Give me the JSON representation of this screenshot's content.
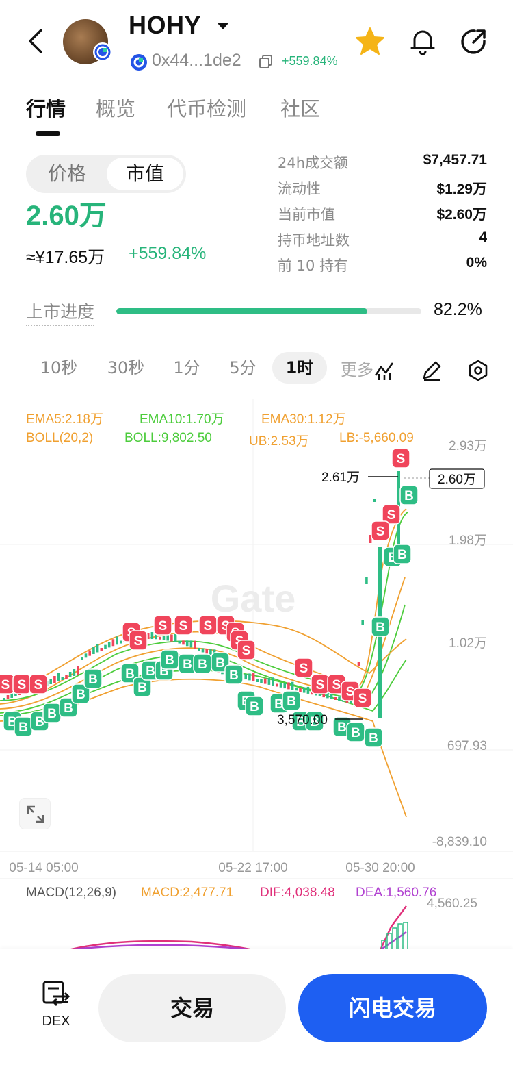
{
  "header": {
    "token_name": "HOHY",
    "address": "0x44...1de2",
    "change_pct": "+559.84%"
  },
  "tabs": [
    {
      "label": "行情",
      "active": true
    },
    {
      "label": "概览",
      "active": false
    },
    {
      "label": "代币检测",
      "active": false
    },
    {
      "label": "社区",
      "active": false
    }
  ],
  "stats": {
    "toggle": {
      "option_1": "价格",
      "option_2": "市值",
      "selected": "市值"
    },
    "market_cap_value": "2.60万",
    "cny_value": "≈¥17.65万",
    "cny_change": "+559.84%",
    "kv": [
      {
        "label": "24h成交额",
        "value": "$7,457.71"
      },
      {
        "label": "流动性",
        "value": "$1.29万"
      },
      {
        "label": "当前市值",
        "value": "$2.60万"
      },
      {
        "label": "持币地址数",
        "value": "4"
      },
      {
        "label": "前 10 持有",
        "value": "0%"
      }
    ],
    "progress": {
      "label": "上市进度",
      "value": "82.2%",
      "fraction": 0.822
    }
  },
  "intervals": {
    "items": [
      "10秒",
      "30秒",
      "1分",
      "5分",
      "1时"
    ],
    "selected": "1时",
    "more_label": "更多"
  },
  "chart": {
    "indicators_row1": [
      {
        "text": "EMA5:2.18万",
        "color": "#f0a030"
      },
      {
        "text": "EMA10:1.70万",
        "color": "#4ccc3c"
      },
      {
        "text": "EMA30:1.12万",
        "color": "#f0a030"
      }
    ],
    "indicators_row2": [
      {
        "text": "BOLL(20,2)",
        "color": "#f0a030"
      },
      {
        "text": "BOLL:9,802.50",
        "color": "#4ccc3c"
      },
      {
        "text": "UB:2.53万",
        "color": "#f0a030"
      },
      {
        "text": "LB:-5,660.09",
        "color": "#f0a030"
      }
    ],
    "y_ticks": [
      "2.93万",
      "1.98万",
      "1.02万",
      "697.93",
      "-8,839.10"
    ],
    "x_ticks": [
      "05-14 05:00",
      "05-22 17:00",
      "05-30 20:00"
    ],
    "max_label": "2.61万",
    "min_label": "3,570.00",
    "current_price_label": "2.60万",
    "watermark": "Gate",
    "marker_buy": "B",
    "marker_sell": "S",
    "macd": [
      {
        "text": "MACD(12,26,9)",
        "color": "#555555"
      },
      {
        "text": "MACD:2,477.71",
        "color": "#f0a030"
      },
      {
        "text": "DIF:4,038.48",
        "color": "#e0307a"
      },
      {
        "text": "DEA:1,560.76",
        "color": "#b040d0"
      }
    ],
    "macd_tick": "4,560.25"
  },
  "bottom": {
    "dex_label": "DEX",
    "trade_label": "交易",
    "flash_trade_label": "闪电交易"
  },
  "colors": {
    "up": "#2ebd85",
    "down": "#f0455b",
    "accent": "#1e5ff2",
    "star": "#f5b417"
  }
}
